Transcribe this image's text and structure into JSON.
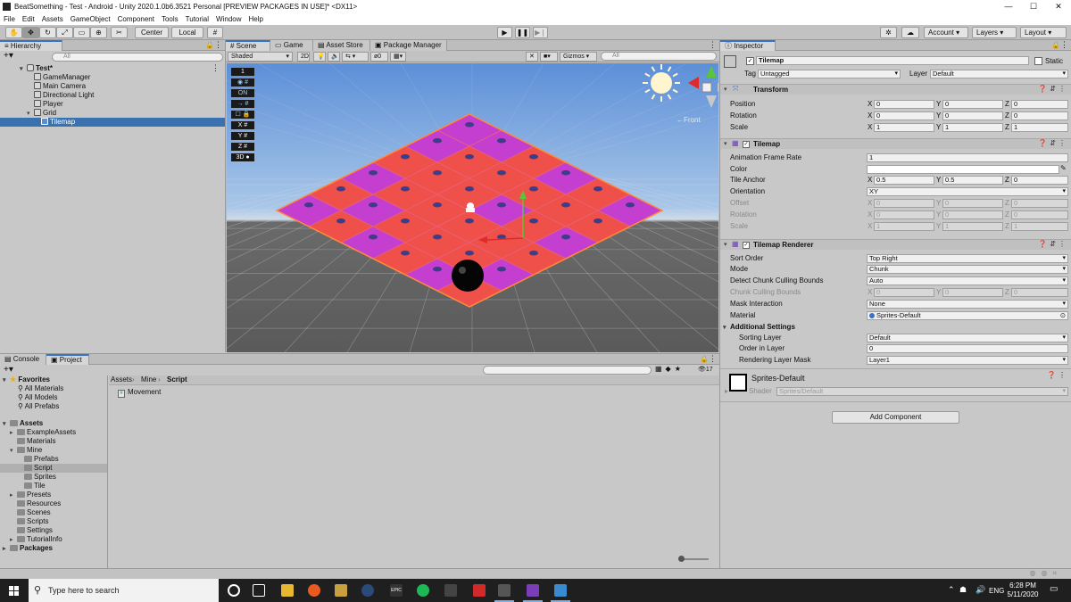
{
  "window": {
    "title": "BeatSomething - Test - Android - Unity 2020.1.0b6.3521 Personal [PREVIEW PACKAGES IN USE]* <DX11>"
  },
  "menu": [
    "File",
    "Edit",
    "Assets",
    "GameObject",
    "Component",
    "Tools",
    "Tutorial",
    "Window",
    "Help"
  ],
  "toolbar": {
    "pivot": "Center",
    "space": "Local",
    "account": "Account",
    "layers": "Layers",
    "layout": "Layout"
  },
  "hierarchy": {
    "tab": "Hierarchy",
    "search_placeholder": "All",
    "scene": "Test*",
    "items": [
      "GameManager",
      "Main Camera",
      "Directional Light",
      "Player",
      "Grid",
      "Tilemap"
    ]
  },
  "scene": {
    "tabs": [
      "Scene",
      "Game",
      "Asset Store",
      "Package Manager"
    ],
    "shading": "Shaded",
    "mode_2d": "2D",
    "fx_count": "0",
    "gizmos": "Gizmos",
    "search_placeholder": "All",
    "front_label": "←Front",
    "overlay_buttons": [
      "1",
      "◉ #",
      "ON",
      "→ #",
      "☐ 🔒",
      "X #",
      "Y #",
      "Z #",
      "3D ●"
    ],
    "colors": {
      "tile_red": "#f0504a",
      "tile_magenta": "#c43fd0",
      "dot": "#3b3f8a"
    }
  },
  "inspector": {
    "tab": "Inspector",
    "object_name": "Tilemap",
    "static_label": "Static",
    "tag_label": "Tag",
    "tag": "Untagged",
    "layer_label": "Layer",
    "layer": "Default",
    "transform": {
      "title": "Transform",
      "rows": [
        {
          "label": "Position",
          "x": "0",
          "y": "0",
          "z": "0"
        },
        {
          "label": "Rotation",
          "x": "0",
          "y": "0",
          "z": "0"
        },
        {
          "label": "Scale",
          "x": "1",
          "y": "1",
          "z": "1"
        }
      ]
    },
    "tilemap": {
      "title": "Tilemap",
      "anim_label": "Animation Frame Rate",
      "anim": "1",
      "color_label": "Color",
      "anchor_label": "Tile Anchor",
      "anchor_x": "0.5",
      "anchor_y": "0.5",
      "anchor_z": "0",
      "orientation_label": "Orientation",
      "orientation": "XY",
      "offset_label": "Offset",
      "rotation_label": "Rotation",
      "scale_label": "Scale",
      "offset": [
        "0",
        "0",
        "0"
      ],
      "rotation": [
        "0",
        "0",
        "0"
      ],
      "scale": [
        "1",
        "1",
        "1"
      ]
    },
    "renderer": {
      "title": "Tilemap Renderer",
      "sort_label": "Sort Order",
      "sort": "Top Right",
      "mode_label": "Mode",
      "mode": "Chunk",
      "detect_label": "Detect Chunk Culling Bounds",
      "detect": "Auto",
      "bounds_label": "Chunk Culling Bounds",
      "bounds": [
        "0",
        "0",
        "0"
      ],
      "mask_label": "Mask Interaction",
      "mask": "None",
      "material_label": "Material",
      "material": "Sprites-Default",
      "additional": "Additional Settings",
      "sorting_layer_label": "Sorting Layer",
      "sorting_layer": "Default",
      "order_label": "Order in Layer",
      "order": "0",
      "rlm_label": "Rendering Layer Mask",
      "rlm": "Layer1"
    },
    "material_block": {
      "name": "Sprites-Default",
      "shader_label": "Shader",
      "shader": "Sprites/Default"
    },
    "add_component": "Add Component"
  },
  "project": {
    "tabs": [
      "Console",
      "Project"
    ],
    "breadcrumb": [
      "Assets",
      "Mine",
      "Script"
    ],
    "hidden_count": "17",
    "tree": {
      "favorites": "Favorites",
      "fav_items": [
        "All Materials",
        "All Models",
        "All Prefabs"
      ],
      "assets": "Assets",
      "asset_items": [
        "ExampleAssets",
        "Materials",
        "Mine"
      ],
      "mine_items": [
        "Prefabs",
        "Script",
        "Sprites",
        "Tile"
      ],
      "more_items": [
        "Presets",
        "Resources",
        "Scenes",
        "Scripts",
        "Settings",
        "TutorialInfo"
      ],
      "packages": "Packages"
    },
    "files": [
      "Movement"
    ]
  },
  "taskbar": {
    "search": "Type here to search",
    "lang": "ENG",
    "time": "6:28 PM",
    "date": "5/11/2020"
  }
}
